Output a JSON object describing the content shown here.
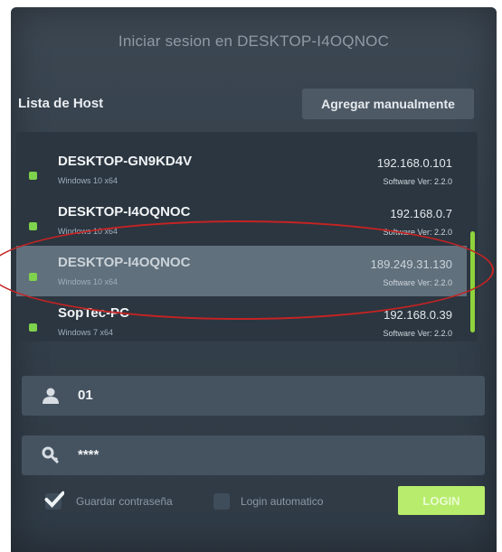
{
  "dialog": {
    "title": "Iniciar sesion en DESKTOP-I4OQNOC"
  },
  "host_list": {
    "label": "Lista de Host",
    "add_manual_label": "Agregar manualmente",
    "hosts": [
      {
        "name": "DESKTOP-GN9KD4V",
        "os": "Windows 10 x64",
        "ip": "192.168.0.101",
        "version": "Software Ver: 2.2.0",
        "selected": false
      },
      {
        "name": "DESKTOP-I4OQNOC",
        "os": "Windows 10 x64",
        "ip": "192.168.0.7",
        "version": "Software Ver: 2.2.0",
        "selected": false
      },
      {
        "name": "DESKTOP-I4OQNOC",
        "os": "Windows 10 x64",
        "ip": "189.249.31.130",
        "version": "Software Ver: 2.2.0",
        "selected": true
      },
      {
        "name": "SopTec-PC",
        "os": "Windows 7 x64",
        "ip": "192.168.0.39",
        "version": "Software Ver: 2.2.0",
        "selected": false
      }
    ]
  },
  "login": {
    "user_value": "01",
    "password_value": "****",
    "save_password_label": "Guardar contraseña",
    "auto_login_label": "Login automatico",
    "login_label": "LOGIN"
  },
  "colors": {
    "status_online": "#7fd24c",
    "login_button": "#b7ec6c",
    "annotation": "#c52323"
  },
  "icons": [
    "user-icon",
    "key-icon",
    "checkmark-icon"
  ]
}
